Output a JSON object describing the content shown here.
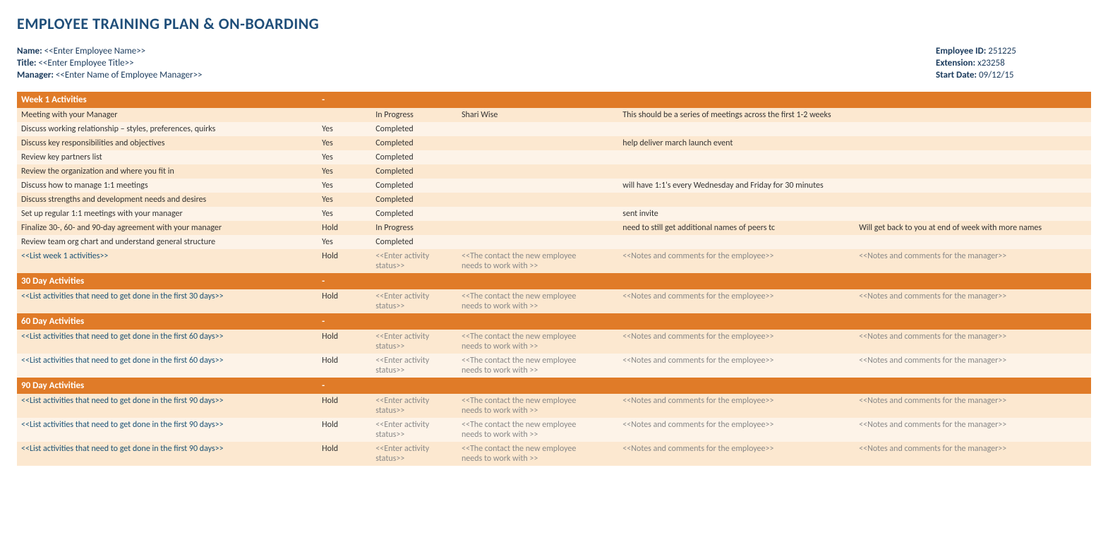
{
  "title": "EMPLOYEE TRAINING PLAN & ON-BOARDING",
  "employee": {
    "name_label": "Name:",
    "name_value": "<<Enter Employee Name>>",
    "title_label": "Title:",
    "title_value": "<<Enter Employee Title>>",
    "manager_label": "Manager:",
    "manager_value": "<<Enter Name of Employee Manager>>",
    "id_label": "Employee ID:",
    "id_value": "251225",
    "ext_label": "Extension:",
    "ext_value": "x23258",
    "start_label": "Start Date:",
    "start_value": "09/12/15"
  },
  "sections": [
    {
      "id": "week1",
      "header": "Week 1 Activities",
      "dash": "-",
      "rows": [
        {
          "activity": "Meeting with your Manager",
          "yes": "",
          "status": "In Progress",
          "contact": "Shari Wise",
          "notes_emp": "This should be a series of meetings across the first 1-2 weeks",
          "notes_mgr": ""
        },
        {
          "activity": "Discuss working relationship – styles, preferences, quirks",
          "yes": "Yes",
          "status": "Completed",
          "contact": "",
          "notes_emp": "",
          "notes_mgr": ""
        },
        {
          "activity": "Discuss key responsibilities and objectives",
          "yes": "Yes",
          "status": "Completed",
          "contact": "",
          "notes_emp": "help deliver march launch event",
          "notes_mgr": ""
        },
        {
          "activity": "Review key partners list",
          "yes": "Yes",
          "status": "Completed",
          "contact": "",
          "notes_emp": "",
          "notes_mgr": ""
        },
        {
          "activity": "Review the organization and where you fit in",
          "yes": "Yes",
          "status": "Completed",
          "contact": "",
          "notes_emp": "",
          "notes_mgr": ""
        },
        {
          "activity": "Discuss how to manage 1:1 meetings",
          "yes": "Yes",
          "status": "Completed",
          "contact": "",
          "notes_emp": "will have 1:1's every Wednesday and Friday for 30 minutes",
          "notes_mgr": ""
        },
        {
          "activity": "Discuss strengths and development needs and desires",
          "yes": "Yes",
          "status": "Completed",
          "contact": "",
          "notes_emp": "",
          "notes_mgr": ""
        },
        {
          "activity": "Set up regular 1:1 meetings with your manager",
          "yes": "Yes",
          "status": "Completed",
          "contact": "",
          "notes_emp": "sent invite",
          "notes_mgr": ""
        },
        {
          "activity": "Finalize 30-, 60- and 90-day agreement with your manager",
          "yes": "Hold",
          "status": "In Progress",
          "contact": "",
          "notes_emp": "need to still get additional names of peers tc",
          "notes_mgr": "Will get back to you at end of week with more names"
        },
        {
          "activity": "Review team org chart and understand general structure",
          "yes": "Yes",
          "status": "Completed",
          "contact": "",
          "notes_emp": "",
          "notes_mgr": ""
        },
        {
          "activity": "<<List week 1 activities>>",
          "yes": "Hold",
          "status": "<<Enter activity status>>",
          "contact": "<<The contact the new employee\nneeds to work with >>",
          "notes_emp": "<<Notes and comments for the employee>>",
          "notes_mgr": "<<Notes and comments for the manager>>"
        }
      ]
    },
    {
      "id": "day30",
      "header": "30 Day Activities",
      "dash": "-",
      "rows": [
        {
          "activity": "<<List activities that need to get done in the first 30 days>>",
          "yes": "Hold",
          "status": "<<Enter activity status>>",
          "contact": "<<The contact the new employee\nneeds to work with >>",
          "notes_emp": "<<Notes and comments for the employee>>",
          "notes_mgr": "<<Notes and comments for the manager>>"
        }
      ]
    },
    {
      "id": "day60",
      "header": "60 Day Activities",
      "dash": "-",
      "rows": [
        {
          "activity": "<<List activities that need to get done in the first 60 days>>",
          "yes": "Hold",
          "status": "<<Enter activity status>>",
          "contact": "<<The contact the new employee\nneeds to work with >>",
          "notes_emp": "<<Notes and comments for the employee>>",
          "notes_mgr": "<<Notes and comments for the manager>>"
        },
        {
          "activity": "<<List activities that need to get done in the first 60 days>>",
          "yes": "Hold",
          "status": "<<Enter activity status>>",
          "contact": "<<The contact the new employee\nneeds to work with >>",
          "notes_emp": "<<Notes and comments for the employee>>",
          "notes_mgr": "<<Notes and comments for the manager>>"
        }
      ]
    },
    {
      "id": "day90",
      "header": "90 Day Activities",
      "dash": "-",
      "rows": [
        {
          "activity": "<<List activities that need to get done in the first 90 days>>",
          "yes": "Hold",
          "status": "<<Enter activity status>>",
          "contact": "<<The contact the new employee\nneeds to work with >>",
          "notes_emp": "<<Notes and comments for the employee>>",
          "notes_mgr": "<<Notes and comments for the manager>>"
        },
        {
          "activity": "<<List activities that need to get done in the first 90 days>>",
          "yes": "Hold",
          "status": "<<Enter activity status>>",
          "contact": "<<The contact the new employee\nneeds to work with >>",
          "notes_emp": "<<Notes and comments for the employee>>",
          "notes_mgr": "<<Notes and comments for the manager>>"
        },
        {
          "activity": "<<List activities that need to get done in the first 90 days>>",
          "yes": "Hold",
          "status": "<<Enter activity status>>",
          "contact": "<<The contact the new employee\nneeds to work with >>",
          "notes_emp": "<<Notes and comments for the employee>>",
          "notes_mgr": "<<Notes and comments for the manager>>"
        }
      ]
    }
  ]
}
